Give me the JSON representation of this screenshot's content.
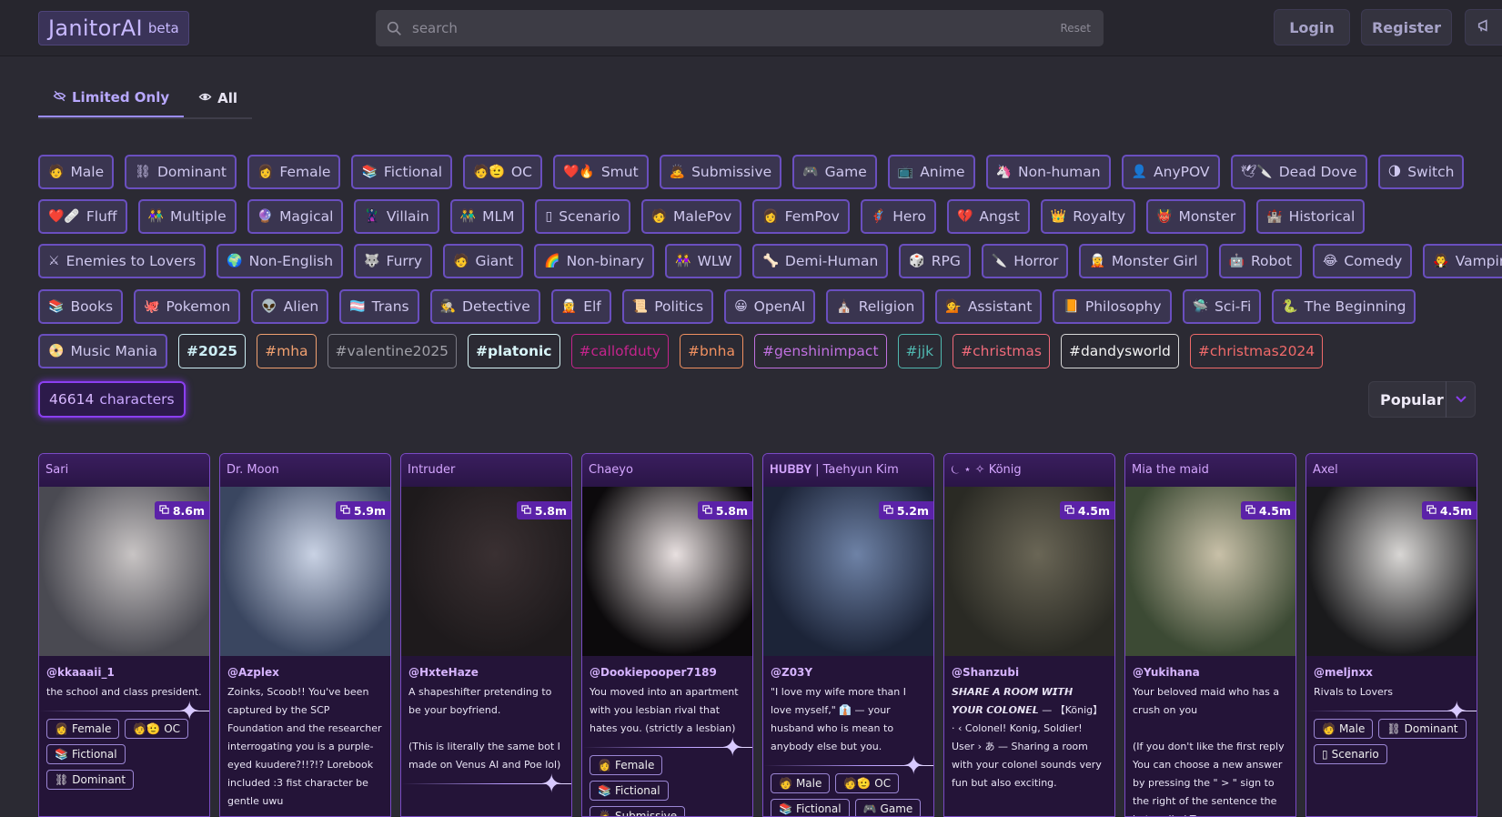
{
  "header": {
    "logo": "JanitorAI",
    "beta": "beta",
    "search_placeholder": "search",
    "reset": "Reset",
    "login": "Login",
    "register": "Register"
  },
  "tabs": [
    {
      "label": "Limited Only",
      "icon": "eye-off-icon"
    },
    {
      "label": "All",
      "icon": "eye-icon"
    }
  ],
  "tag_rows": [
    [
      {
        "label": "Male",
        "icon": "🧑"
      },
      {
        "label": "Dominant",
        "icon": "⛓"
      },
      {
        "label": "Female",
        "icon": "👩"
      },
      {
        "label": "Fictional",
        "icon": "📚"
      },
      {
        "label": "OC",
        "icon": "🧑🫡"
      },
      {
        "label": "Smut",
        "icon": "❤️🔥"
      },
      {
        "label": "Submissive",
        "icon": "🙇"
      },
      {
        "label": "Game",
        "icon": "🎮"
      },
      {
        "label": "Anime",
        "icon": "📺"
      },
      {
        "label": "Non-human",
        "icon": "🦄"
      },
      {
        "label": "AnyPOV",
        "icon": "👤"
      },
      {
        "label": "Dead Dove",
        "icon": "🕊🔪"
      },
      {
        "label": "Switch",
        "icon": "🌗"
      }
    ],
    [
      {
        "label": "Fluff",
        "icon": "❤️🩹"
      },
      {
        "label": "Multiple",
        "icon": "👫"
      },
      {
        "label": "Magical",
        "icon": "🔮"
      },
      {
        "label": "Villain",
        "icon": "🦹"
      },
      {
        "label": "MLM",
        "icon": "👬"
      },
      {
        "label": "Scenario",
        "icon": "▯"
      },
      {
        "label": "MalePov",
        "icon": "🧑"
      },
      {
        "label": "FemPov",
        "icon": "👩"
      },
      {
        "label": "Hero",
        "icon": "🦸"
      },
      {
        "label": "Angst",
        "icon": "💔"
      },
      {
        "label": "Royalty",
        "icon": "👑"
      },
      {
        "label": "Monster",
        "icon": "👹"
      },
      {
        "label": "Historical",
        "icon": "🏰"
      }
    ],
    [
      {
        "label": "Enemies to Lovers",
        "icon": "⚔"
      },
      {
        "label": "Non-English",
        "icon": "🌍"
      },
      {
        "label": "Furry",
        "icon": "🐺"
      },
      {
        "label": "Giant",
        "icon": "🧑"
      },
      {
        "label": "Non-binary",
        "icon": "🌈"
      },
      {
        "label": "WLW",
        "icon": "👭"
      },
      {
        "label": "Demi-Human",
        "icon": "🦴"
      },
      {
        "label": "RPG",
        "icon": "🎲"
      },
      {
        "label": "Horror",
        "icon": "🔪"
      },
      {
        "label": "Monster Girl",
        "icon": "🧝"
      },
      {
        "label": "Robot",
        "icon": "🤖"
      },
      {
        "label": "Comedy",
        "icon": "😂"
      },
      {
        "label": "Vampire",
        "icon": "🧛"
      }
    ],
    [
      {
        "label": "Books",
        "icon": "📚"
      },
      {
        "label": "Pokemon",
        "icon": "🐙"
      },
      {
        "label": "Alien",
        "icon": "👽"
      },
      {
        "label": "Trans",
        "icon": "🏳️‍⚧️"
      },
      {
        "label": "Detective",
        "icon": "🕵"
      },
      {
        "label": "Elf",
        "icon": "🧝"
      },
      {
        "label": "Politics",
        "icon": "📜"
      },
      {
        "label": "OpenAI",
        "icon": "😀"
      },
      {
        "label": "Religion",
        "icon": "⛪"
      },
      {
        "label": "Assistant",
        "icon": "💁"
      },
      {
        "label": "Philosophy",
        "icon": "📙"
      },
      {
        "label": "Sci-Fi",
        "icon": "🛸"
      },
      {
        "label": "The Beginning",
        "icon": "🐍"
      }
    ]
  ],
  "last_row": {
    "music": {
      "label": "Music Mania",
      "icon": "📀"
    },
    "hashtags": [
      {
        "label": "#2025",
        "color": "#cdeef5",
        "border": "#cdeef5",
        "bold": true
      },
      {
        "label": "#mha",
        "color": "#f0a070",
        "border": "#f0a070",
        "bold": false
      },
      {
        "label": "#valentine2025",
        "color": "#a0a0a8",
        "border": "#7a7a84",
        "bold": false
      },
      {
        "label": "#platonic",
        "color": "#d8f5f8",
        "border": "#d8f5f8",
        "bold": true
      },
      {
        "label": "#callofduty",
        "color": "#c4248c",
        "border": "#c4248c",
        "bold": false
      },
      {
        "label": "#bnha",
        "color": "#f09060",
        "border": "#f09060",
        "bold": false
      },
      {
        "label": "#genshinimpact",
        "color": "#c070e0",
        "border": "#c070e0",
        "bold": false
      },
      {
        "label": "#jjk",
        "color": "#50b8b0",
        "border": "#50b8b0",
        "bold": false
      },
      {
        "label": "#christmas",
        "color": "#f06a7a",
        "border": "#f06a7a",
        "bold": false
      },
      {
        "label": "#dandysworld",
        "color": "#f2f2f2",
        "border": "#d8d8d8",
        "bold": false
      },
      {
        "label": "#christmas2024",
        "color": "#f06a6a",
        "border": "#f06a6a",
        "bold": false
      }
    ]
  },
  "count": {
    "number": "46614",
    "label": "characters"
  },
  "sort": {
    "label": "Popular"
  },
  "cards": [
    {
      "title": "Sari",
      "stat": "8.6m",
      "author": "@kkaaaii_1",
      "desc": "  the school and class president.",
      "tags": [
        "Female",
        "OC",
        "Fictional",
        "Dominant"
      ],
      "tag_icons": [
        "👩",
        "🧑🫡",
        "📚",
        "⛓"
      ],
      "c1": "#4a4a52",
      "c2": "#c8c4c4",
      "sep": true
    },
    {
      "title": "Dr. Moon",
      "stat": "5.9m",
      "author": "@Azplex",
      "desc": "Zoinks, Scoob!! You've been captured by the SCP Foundation and the researcher interrogating you is a purple-eyed kuudere?!!?!? Lorebook included :3 fist character be gentle uwu",
      "tags": [],
      "tag_icons": [],
      "c1": "#3a4660",
      "c2": "#c9d2e4",
      "sep": false
    },
    {
      "title": "Intruder",
      "stat": "5.8m",
      "author": "@HxteHaze",
      "desc": "A shapeshifter pretending to be your boyfriend.\n\n(This is literally the same bot I made on Venus AI and Poe lol)",
      "tags": [],
      "tag_icons": [],
      "c1": "#1e1a1c",
      "c2": "#3a3032",
      "sep": true
    },
    {
      "title": "Chaeyo",
      "stat": "5.8m",
      "author": "@Dookiepooper7189",
      "desc": "You moved into an apartment with you lesbian rival that hates you. (strictly a lesbian)",
      "tags": [
        "Female",
        "Fictional",
        "Submissive"
      ],
      "tag_icons": [
        "👩",
        "📚",
        "🙇"
      ],
      "c1": "#0c0a0c",
      "c2": "#e8e0e0",
      "sep": true
    },
    {
      "title": "𝐇𝐔𝐁𝐁𝐘 | Taehyun Kim",
      "stat": "5.2m",
      "author": "@Z03Y",
      "desc": "\"I love my wife more than I love myself,\" 👔 — your husband who is mean to anybody else but you.",
      "tags": [
        "Male",
        "OC",
        "Fictional",
        "Game"
      ],
      "tag_icons": [
        "🧑",
        "🧑🫡",
        "📚",
        "🎮"
      ],
      "c1": "#1c2438",
      "c2": "#6e82a6",
      "sep": true
    },
    {
      "title": "⏾ ⋆ ✧ König",
      "stat": "4.5m",
      "author": "@Shanzubi",
      "desc": "𝙎𝙃𝘼𝙍𝙀 𝘼 𝙍𝙊𝙊𝙈 𝙒𝙄𝙏𝙃 𝙔𝙊𝙐𝙍 𝘾𝙊𝙇𝙊𝙉𝙀𝙇 — 【König】 · ‹ Colonel! Konig, Soldier! User › あ — Sharing a room with your colonel sounds very fun but also exciting.",
      "tags": [],
      "tag_icons": [],
      "c1": "#2a2a24",
      "c2": "#6a6656",
      "sep": false
    },
    {
      "title": "Mia the maid",
      "stat": "4.5m",
      "author": "@Yukihana",
      "desc": "Your beloved maid who has a crush on you\n\n(If you don't like the first reply You can choose a new answer by pressing the \" > \" sign to the right of the sentence the bot replied To",
      "tags": [],
      "tag_icons": [],
      "c1": "#3c4a34",
      "c2": "#c8c0a8",
      "sep": false
    },
    {
      "title": "Axel",
      "stat": "4.5m",
      "author": "@meljnxx",
      "desc": "Rivals to Lovers",
      "tags": [
        "Male",
        "Dominant",
        "Scenario"
      ],
      "tag_icons": [
        "🧑",
        "⛓",
        "▯"
      ],
      "c1": "#1a1a1c",
      "c2": "#d8d6d4",
      "sep": true
    }
  ],
  "colors": {
    "accent": "#8b3ff0",
    "tag_border": "#6a4fbf",
    "card_bg": "#241438"
  }
}
